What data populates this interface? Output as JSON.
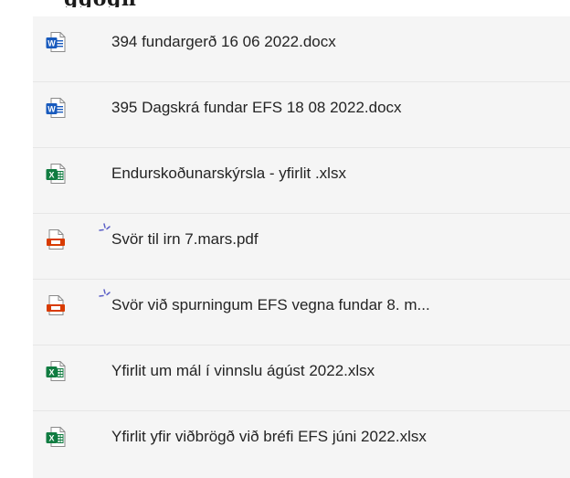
{
  "header": {
    "cut_text": "ggögn"
  },
  "colors": {
    "word": "#185abd",
    "excel": "#107c41",
    "pdf": "#d83b01",
    "new_indicator": "#5b5fc7"
  },
  "files": [
    {
      "name": "394 fundargerð 16 06 2022.docx",
      "icon": "word-icon",
      "new": false
    },
    {
      "name": "395 Dagskrá fundar EFS 18 08 2022.docx",
      "icon": "word-icon",
      "new": false
    },
    {
      "name": "Endurskoðunarskýrsla - yfirlit .xlsx",
      "icon": "excel-icon",
      "new": false
    },
    {
      "name": "Svör til irn 7.mars.pdf",
      "icon": "pdf-icon",
      "new": true
    },
    {
      "name": "Svör við spurningum EFS vegna fundar 8. m...",
      "icon": "pdf-icon",
      "new": true
    },
    {
      "name": "Yfirlit um mál í vinnslu ágúst 2022.xlsx",
      "icon": "excel-icon",
      "new": false
    },
    {
      "name": "Yfirlit yfir viðbrögð við bréfi EFS júni 2022.xlsx",
      "icon": "excel-icon",
      "new": false
    }
  ]
}
